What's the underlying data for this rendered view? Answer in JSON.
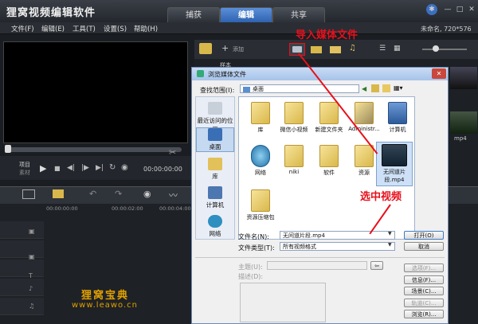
{
  "app": {
    "title": "狸窝视频编辑软件",
    "tabs": [
      "捕获",
      "编辑",
      "共享"
    ],
    "active_tab": "编辑",
    "project_info": "未命名, 720*576"
  },
  "menu": [
    "文件(F)",
    "编辑(E)",
    "工具(T)",
    "设置(S)",
    "帮助(H)"
  ],
  "player": {
    "mode_label_1": "项目",
    "mode_label_2": "素材",
    "timecode": "00:00:00:00"
  },
  "library": {
    "add_label": "添加",
    "partial_label": "样本",
    "thumb_label": "mp4"
  },
  "timeline": {
    "ruler_start": "00:00:00:00",
    "ruler_mid": "00:00:02:00",
    "ruler_right": "00:00:04:00"
  },
  "dialog": {
    "title": "浏览媒体文件",
    "lookin_label": "查找范围(I):",
    "lookin_value": "桌面",
    "sidebar": [
      "最近访问的位置",
      "桌面",
      "库",
      "计算机",
      "网络"
    ],
    "files": [
      {
        "name": "库",
        "kind": "library"
      },
      {
        "name": "微信小视频",
        "kind": "folder"
      },
      {
        "name": "新建文件夹",
        "kind": "folder"
      },
      {
        "name": "Administr...",
        "kind": "user"
      },
      {
        "name": "计算机",
        "kind": "computer"
      },
      {
        "name": "网络",
        "kind": "network"
      },
      {
        "name": "niki",
        "kind": "folder"
      },
      {
        "name": "软件",
        "kind": "folder"
      },
      {
        "name": "资源",
        "kind": "folder"
      },
      {
        "name": "无间道片段.mp4",
        "kind": "video"
      },
      {
        "name": "资源压缩包",
        "kind": "folder"
      }
    ],
    "filename_label": "文件名(N):",
    "filename_value": "无间道片段.mp4",
    "filetype_label": "文件类型(T):",
    "filetype_value": "所有视频格式",
    "open_button": "打开(O)",
    "cancel_button": "取消",
    "subject_label": "主题(U):",
    "desc_label": "描述(D):",
    "options_button": "选项(F)...",
    "info_button": "信息(F)...",
    "scene_button": "场景(C)...",
    "track_button": "轨道(C)...",
    "browse_button": "浏览(R)..."
  },
  "annotations": {
    "import_hint": "导入媒体文件",
    "select_hint": "选中视频",
    "watermark_title": "狸窝宝典",
    "watermark_url": "www.leawo.cn"
  },
  "colors": {
    "accent_red": "#e8101c",
    "tab_active": "#3f74c2",
    "watermark": "#e0a000"
  }
}
